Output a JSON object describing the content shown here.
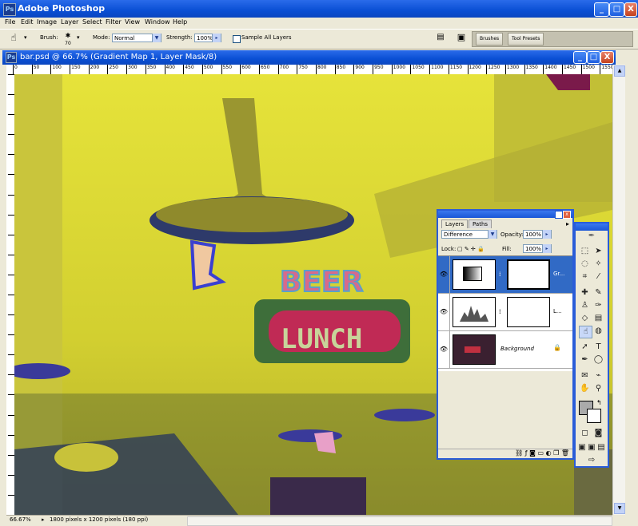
{
  "app": {
    "title": "Adobe Photoshop",
    "icon": "photoshop-icon"
  },
  "window_controls": {
    "minimize": "_",
    "restore": "□",
    "close": "X"
  },
  "menu": [
    "File",
    "Edit",
    "Image",
    "Layer",
    "Select",
    "Filter",
    "View",
    "Window",
    "Help"
  ],
  "options": {
    "tool_icon": "smudge-tool-icon",
    "brush_label": "Brush:",
    "brush_size": "70",
    "mode_label": "Mode:",
    "mode_value": "Normal",
    "strength_label": "Strength:",
    "strength_value": "100%",
    "sample_all_label": "Sample All Layers",
    "brushes_tab": "Brushes",
    "tool_presets_tab": "Tool Presets"
  },
  "document": {
    "title": "bar.psd @ 66.7% (Gradient Map 1, Layer Mask/8)",
    "ruler_ticks": [
      "0",
      "50",
      "100",
      "150",
      "200",
      "250",
      "300",
      "350",
      "400",
      "450",
      "500",
      "550",
      "600",
      "650",
      "700",
      "750",
      "800",
      "850",
      "900",
      "950",
      "1000",
      "1050",
      "1100",
      "1150",
      "1200",
      "1250",
      "1300",
      "1350",
      "1400",
      "1450",
      "1500",
      "1550"
    ],
    "zoom": "66.67%",
    "status": "1800 pixels x 1200 pixels (180 ppi)",
    "sign_beer": "BEER",
    "sign_lunch": "LUNCH"
  },
  "layers_panel": {
    "tabs": [
      "Layers",
      "Paths"
    ],
    "blend_mode": "Difference",
    "opacity_label": "Opacity:",
    "opacity_value": "100%",
    "lock_label": "Lock:",
    "fill_label": "Fill:",
    "fill_value": "100%",
    "layers": [
      {
        "name": "Gr...",
        "selected": true
      },
      {
        "name": "L...",
        "selected": false
      },
      {
        "name": "Background",
        "selected": false
      }
    ]
  },
  "colors": {
    "accent": "#316ac5",
    "titlebar": "#0a4fd4",
    "canvas_yellow": "#d8d82a"
  }
}
